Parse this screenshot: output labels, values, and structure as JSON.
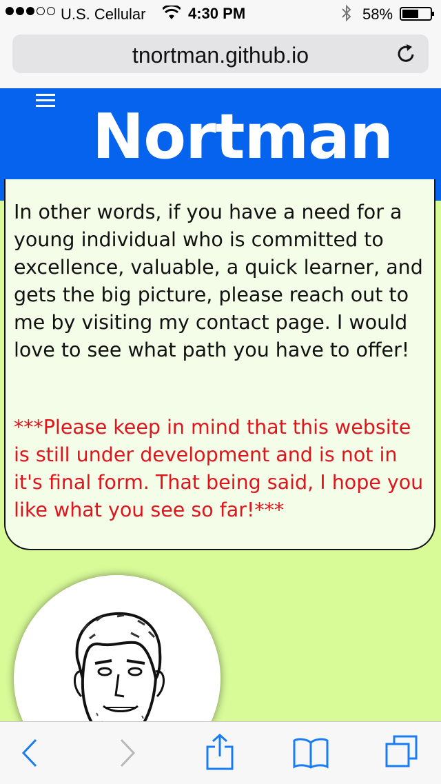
{
  "status_bar": {
    "carrier": "U.S. Cellular",
    "time": "4:30 PM",
    "battery_percent": "58%",
    "signal_bars_filled": 3,
    "signal_bars_total": 5,
    "battery_level": 0.58
  },
  "browser": {
    "url": "tnortman.github.io"
  },
  "site": {
    "title": "Nortman"
  },
  "content": {
    "paragraph_1": "In other words, if you have a need for a young individual who is committed to excellence, valuable, a quick learner, and gets the big picture, please reach out to me by visiting my contact page. I would love to see what path you have to offer!",
    "paragraph_2": "***Please keep in mind that this website is still under development and is not in it's final form. That being said, I hope you like what you see so far!***"
  },
  "colors": {
    "page_background": "#d8fb98",
    "header_background": "#0563ee",
    "card_background": "#f3fde8",
    "warning_text": "#e0141c",
    "ios_blue": "#1a7cf5"
  },
  "icons": {
    "back": "chevron-left-icon",
    "forward": "chevron-right-icon",
    "share": "share-icon",
    "bookmarks": "book-icon",
    "tabs": "tabs-icon",
    "reload": "reload-icon",
    "menu": "hamburger-icon"
  }
}
